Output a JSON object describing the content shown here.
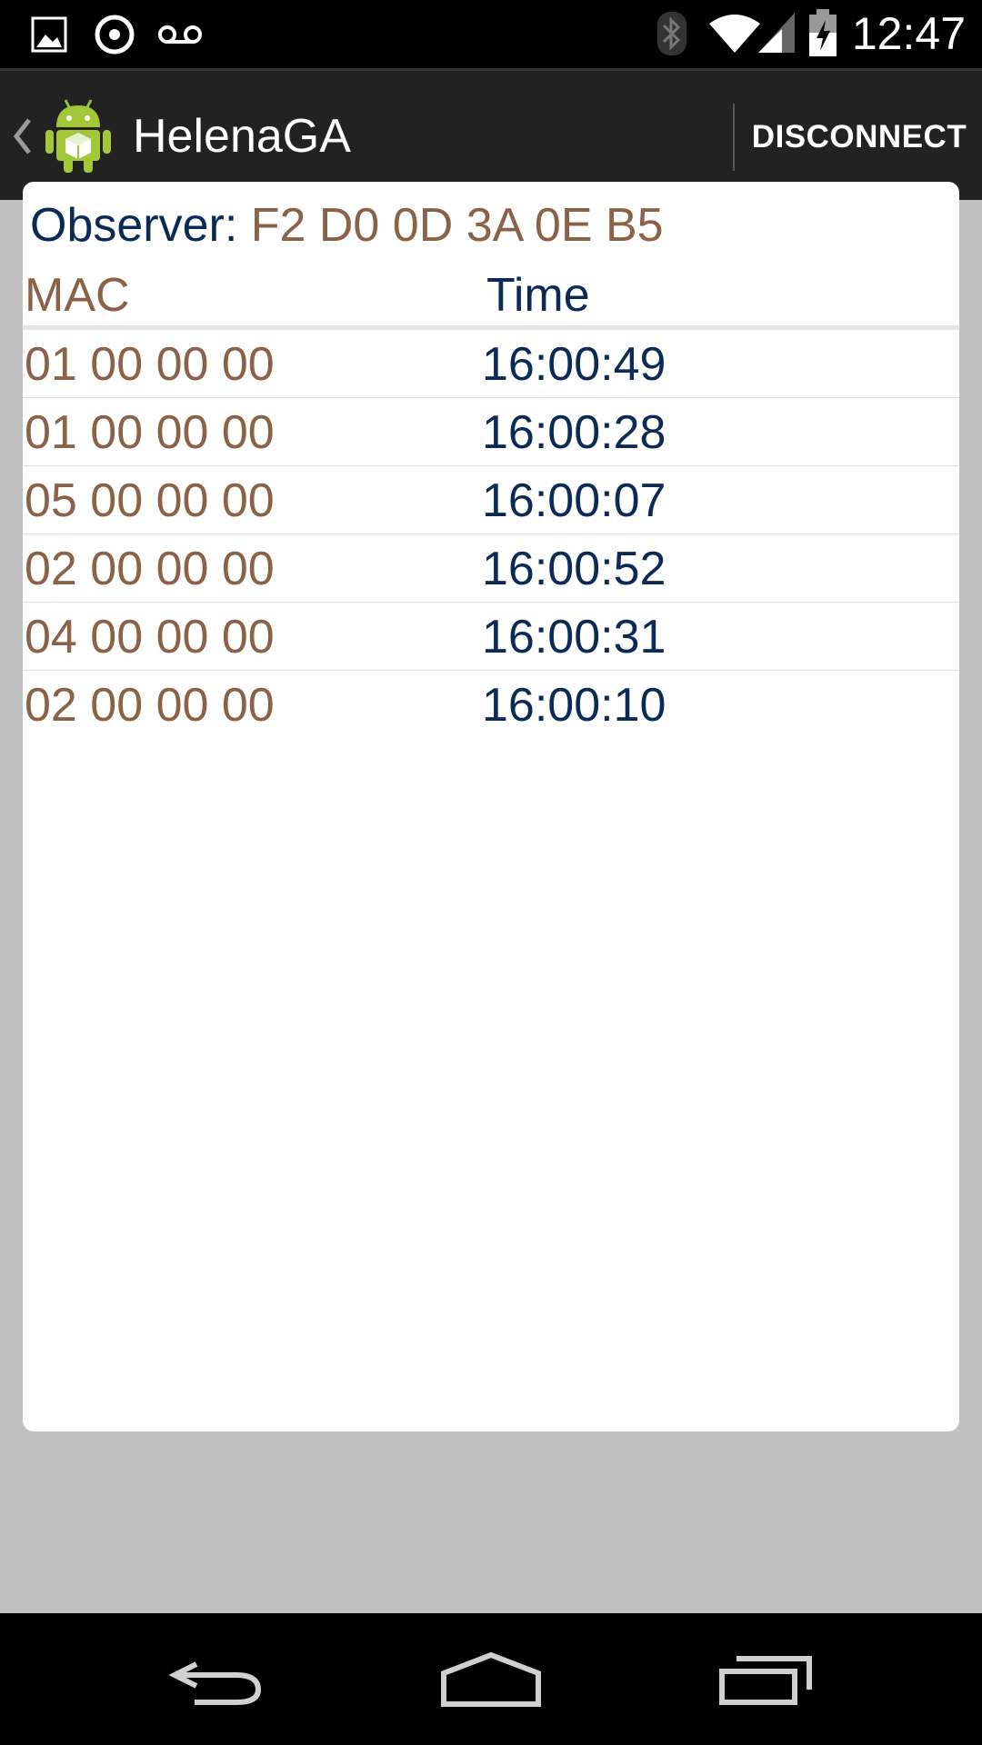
{
  "status_bar": {
    "time": "12:47",
    "left_icons": [
      "gallery-icon",
      "sync-icon",
      "voicemail-icon"
    ],
    "right_icons": [
      "bluetooth-icon",
      "wifi-icon",
      "signal-icon",
      "battery-icon"
    ]
  },
  "action_bar": {
    "title": "HelenaGA",
    "action_label": "DISCONNECT"
  },
  "observer": {
    "label": "Observer:",
    "value": "F2 D0 0D 3A 0E B5"
  },
  "table": {
    "headers": {
      "mac": "MAC",
      "time": "Time"
    },
    "rows": [
      {
        "mac": "01 00 00 00",
        "time": "16:00:49"
      },
      {
        "mac": "01 00 00 00",
        "time": "16:00:28"
      },
      {
        "mac": "05 00 00 00",
        "time": "16:00:07"
      },
      {
        "mac": "02 00 00 00",
        "time": "16:00:52"
      },
      {
        "mac": "04 00 00 00",
        "time": "16:00:31"
      },
      {
        "mac": "02 00 00 00",
        "time": "16:00:10"
      }
    ]
  },
  "colors": {
    "mac_text": "#8b6247",
    "time_text": "#0b2a55",
    "action_bar_bg": "#222222",
    "content_bg": "#c1c1c1"
  },
  "nav_bar": {
    "buttons": [
      "back-icon",
      "home-icon",
      "recents-icon"
    ]
  }
}
